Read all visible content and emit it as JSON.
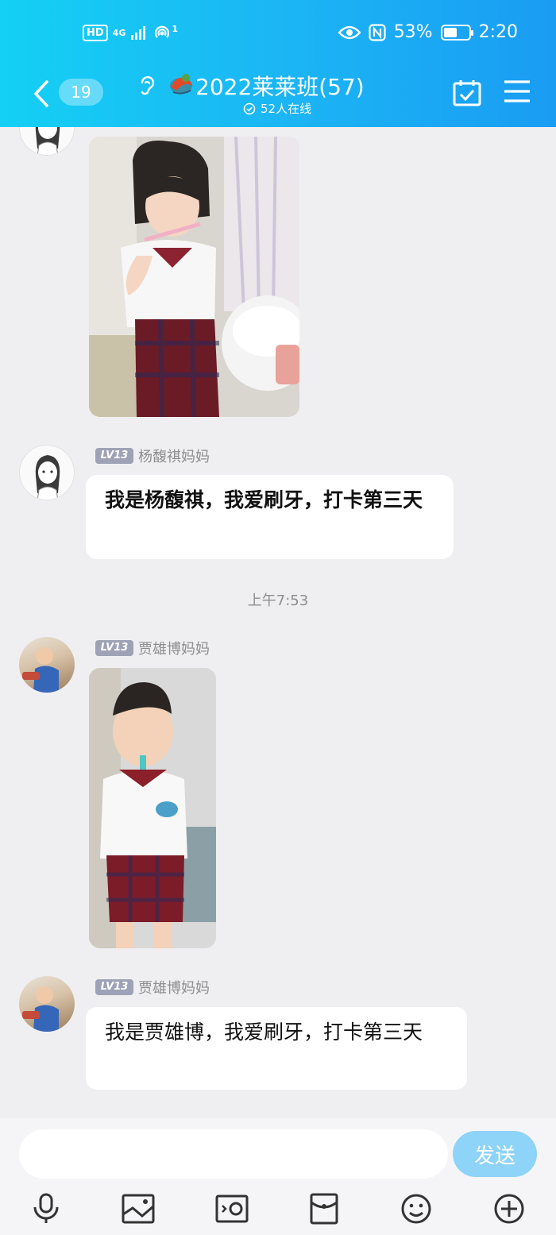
{
  "statusbar": {
    "left_badge": "HD",
    "signal_text": "4G",
    "hotspot_count": "1",
    "battery_percent": "53%",
    "battery_level": 0.53,
    "time": "2:20"
  },
  "header": {
    "unread_count": "19",
    "group_title": "2022莱莱班(57)",
    "online_text": "52人在线"
  },
  "messages": [
    {
      "sender_level": "LV13",
      "sender": "杨馥祺妈妈",
      "text": "我是杨馥祺，我爱刷牙，打卡第三天"
    },
    {
      "timestamp": "上午7:53"
    },
    {
      "sender_level": "LV13",
      "sender": "贾雄博妈妈"
    },
    {
      "sender_level": "LV13",
      "sender": "贾雄博妈妈",
      "text": "我是贾雄博，我爱刷牙，打卡第三天"
    }
  ],
  "inputbar": {
    "placeholder": "",
    "send_label": "发送"
  },
  "toolbar": {
    "icons": [
      "microphone-icon",
      "image-icon",
      "camera-icon",
      "red-packet-icon",
      "emoji-icon",
      "plus-icon"
    ]
  },
  "colors": {
    "header_start": "#14d0f4",
    "header_end": "#1a9cf3",
    "chat_bg": "#efeff1",
    "send_button": "#8ed3f8",
    "level_badge": "#9ea2b6"
  }
}
